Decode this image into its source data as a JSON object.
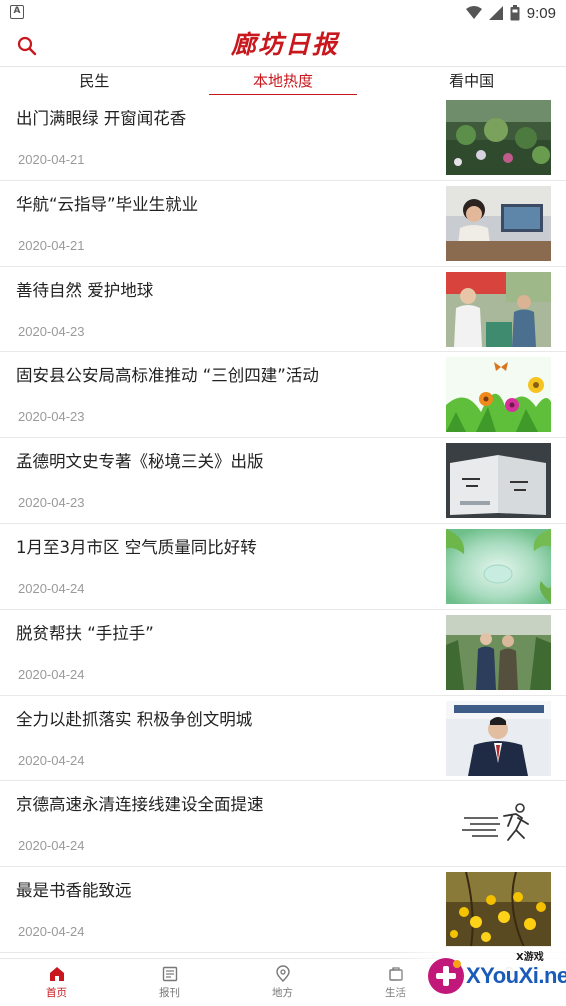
{
  "status_bar": {
    "time": "9:09",
    "notification": "A"
  },
  "header": {
    "brand": "廊坊日报",
    "search_icon": "search-icon"
  },
  "tabs": [
    {
      "label": "民生",
      "active": false
    },
    {
      "label": "本地热度",
      "active": true
    },
    {
      "label": "看中国",
      "active": false
    }
  ],
  "news": [
    {
      "title": "出门满眼绿 开窗闻花香",
      "date": "2020-04-21",
      "thumb": "garden-flowers"
    },
    {
      "title": "华航“云指导”毕业生就业",
      "date": "2020-04-21",
      "thumb": "person-at-computer"
    },
    {
      "title": "善待自然 爱护地球",
      "date": "2020-04-23",
      "thumb": "volunteers-outdoors"
    },
    {
      "title": "固安县公安局高标准推动 “三创四建”活动",
      "date": "2020-04-23",
      "thumb": "flowers-butterfly"
    },
    {
      "title": "孟德明文史专著《秘境三关》出版",
      "date": "2020-04-23",
      "thumb": "book-cover"
    },
    {
      "title": "1月至3月市区 空气质量同比好转",
      "date": "2020-04-24",
      "thumb": "water-drop-green"
    },
    {
      "title": "脱贫帮扶 “手拉手”",
      "date": "2020-04-24",
      "thumb": "greenhouse-people"
    },
    {
      "title": "全力以赴抓落实 积极争创文明城",
      "date": "2020-04-24",
      "thumb": "official-portrait"
    },
    {
      "title": "京德高速永清连接线建设全面提速",
      "date": "2020-04-24",
      "thumb": "running-man-icon"
    },
    {
      "title": "最是书香能致远",
      "date": "2020-04-24",
      "thumb": "yellow-blossoms"
    }
  ],
  "bottom_nav": [
    {
      "label": "首页",
      "icon": "home-icon",
      "active": true
    },
    {
      "label": "报刊",
      "icon": "newspaper-icon",
      "active": false
    },
    {
      "label": "地方",
      "icon": "location-icon",
      "active": false
    },
    {
      "label": "生活",
      "icon": "life-icon",
      "active": false
    },
    {
      "label": "",
      "icon": "profile-icon",
      "active": false
    }
  ],
  "watermark": {
    "text": "XYouXi.net",
    "sub": "X游戏"
  },
  "colors": {
    "accent": "#c8171d",
    "date_gray": "#9a9a9a",
    "divider": "#e8e8e8"
  }
}
